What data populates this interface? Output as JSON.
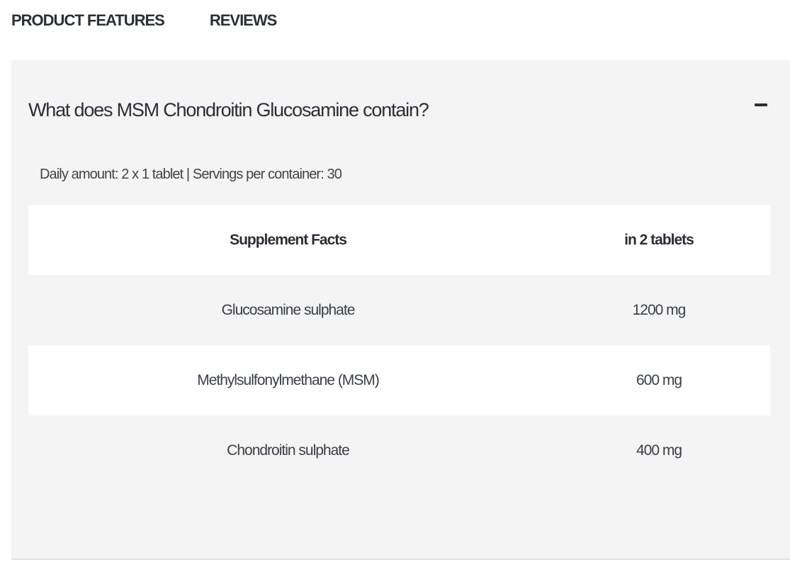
{
  "tabs": [
    {
      "label": "PRODUCT FEATURES"
    },
    {
      "label": "REVIEWS"
    }
  ],
  "accordion": {
    "title": "What does MSM Chondroitin Glucosamine contain?",
    "toggle_icon": "minus-icon",
    "meta": "Daily amount: 2 x 1 tablet | Servings per container: 30"
  },
  "table": {
    "headers": [
      "Supplement Facts",
      "in 2 tablets"
    ],
    "rows": [
      {
        "name": "Glucosamine sulphate",
        "amount": "1200 mg"
      },
      {
        "name": "Methylsulfonylmethane (MSM)",
        "amount": "600 mg"
      },
      {
        "name": "Chondroitin sulphate",
        "amount": "400 mg"
      }
    ]
  },
  "colors": {
    "panel_background": "#f4f4f4",
    "row_white": "#ffffff",
    "text_dark": "#2a2f36"
  }
}
